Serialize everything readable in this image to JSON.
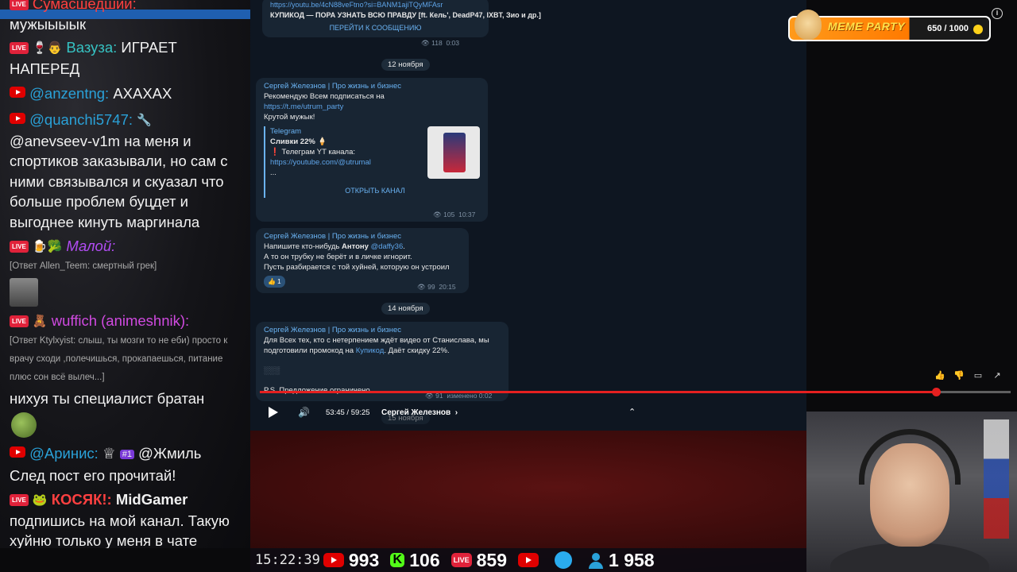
{
  "chat": {
    "messages": [
      {
        "nick": "Сумасшедший:",
        "text": "мужыыыык"
      },
      {
        "nick": "Вазуза:",
        "text": "ИГРАЕТ НАПЕРЕД"
      },
      {
        "nick": "@anzentng:",
        "text": "АХАХАХ"
      },
      {
        "nick": "@quanchi5747:",
        "text": "@anevseev-v1m на меня и спортиков заказывали, но сам с ними связывался и скуазал что больше проблем буцдет и выгоднее кинуть маргинала"
      },
      {
        "nick": "Малой:",
        "reply": "[Ответ Allen_Teem: смертный грек]"
      },
      {
        "nick": "wuffich (animeshnik):",
        "reply": "[Ответ Ktylxyist: слыш, ты мозги то не еби) просто к врачу сходи ,полечишься, прокапаешься, питание плюс сон всё вылеч...]",
        "text": "нихуя ты специалист братан"
      },
      {
        "nick": "@Аринис:",
        "badge": "#1",
        "mention": "@Жмиль",
        "text": "След пост его прочитай!"
      },
      {
        "nick": "КОСЯК!:",
        "nick2": "MidGamer",
        "text": "подпишись на мой канал. Такую хуйню только у меня в чате писать можно"
      }
    ]
  },
  "telegram": {
    "top_link": "https://youtu.be/4cN88veFtno?si=BANM1ajiTQyMFAsr",
    "top_title": "КУПИКОД — ПОРА УЗНАТЬ ВСЮ ПРАВДУ [ft. Кель', DeadP47, IXBT, Зио и др.]",
    "top_button": "ПЕРЕЙТИ К СООБЩЕНИЮ",
    "top_views": "118",
    "top_time": "0:03",
    "date1": "12 ноября",
    "post1": {
      "author": "Сергей Железнов | Про жизнь и бизнес",
      "line1": "Рекомендую Всем подписаться на",
      "link": "https://t.me/utrum_party",
      "line2": "Крутой мужык!",
      "preview_site": "Telegram",
      "preview_title": "Сливки 22% 🍦",
      "preview_line": "Телеграм YT канала:",
      "preview_link": "https://youtube.com/@utrumal",
      "preview_more": "...",
      "button": "ОТКРЫТЬ КАНАЛ",
      "views": "105",
      "time": "10:37"
    },
    "post2": {
      "author": "Сергей Железнов | Про жизнь и бизнес",
      "line1a": "Напишите кто-нибудь ",
      "line1b": "Антону",
      "line1c": "@daffy36",
      "line2": "А то он трубку не берёт и в личке игнорит.",
      "line3": "Пусть разбирается с той хуйней, которую он устроил",
      "reaction": "👍 1",
      "views": "99",
      "time": "20:15"
    },
    "date2": "14 ноября",
    "post3": {
      "author": "Сергей Железнов | Про жизнь и бизнес",
      "line1": "Для Всех тех, кто с нетерпением ждёт видео от Станислава, мы подготовили промокод на",
      "link": "Купикод",
      "line1end": ". Даёт скидку 22%.",
      "line3": "P.S. Предложение ограничено...",
      "views": "91",
      "edited": "изменено 0:02"
    },
    "date3": "15 ноября"
  },
  "player": {
    "time": "53:45 / 59:25",
    "chapter": "Сергей Железнов",
    "progress": 0.9
  },
  "meme_party": {
    "title": "MEME PARTY",
    "score": "650 / 1000"
  },
  "stats": {
    "clock": "15:22:39",
    "youtube": "993",
    "kick": "106",
    "live": "859",
    "total": "1 958",
    "kick_letter": "K",
    "live_label": "LIVE"
  }
}
